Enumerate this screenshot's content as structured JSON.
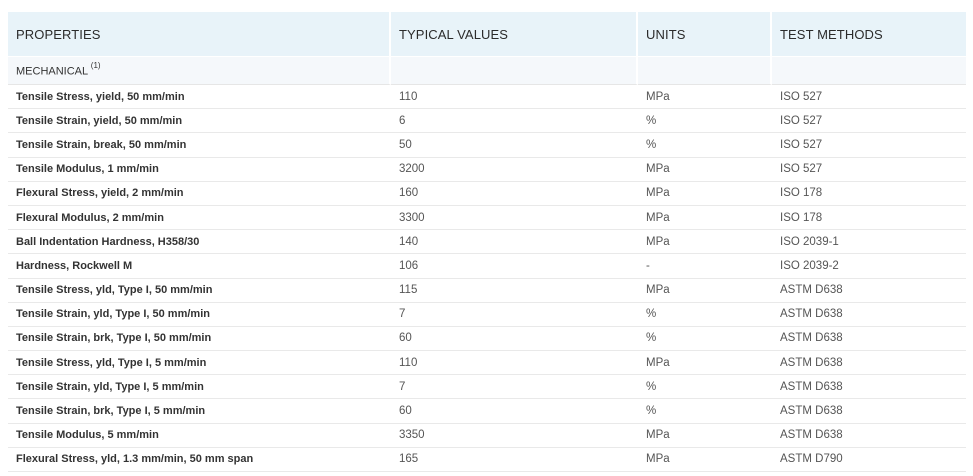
{
  "headers": {
    "properties": "PROPERTIES",
    "typical_values": "TYPICAL VALUES",
    "units": "UNITS",
    "test_methods": "TEST METHODS"
  },
  "section": {
    "label": "MECHANICAL",
    "footnote": "(1)"
  },
  "rows": [
    {
      "property": "Tensile Stress, yield, 50 mm/min",
      "value": "110",
      "unit": "MPa",
      "method": "ISO 527"
    },
    {
      "property": "Tensile Strain, yield, 50 mm/min",
      "value": "6",
      "unit": "%",
      "method": "ISO 527"
    },
    {
      "property": "Tensile Strain, break, 50 mm/min",
      "value": "50",
      "unit": "%",
      "method": "ISO 527"
    },
    {
      "property": "Tensile Modulus, 1 mm/min",
      "value": "3200",
      "unit": "MPa",
      "method": "ISO 527"
    },
    {
      "property": "Flexural Stress, yield, 2 mm/min",
      "value": "160",
      "unit": "MPa",
      "method": "ISO 178"
    },
    {
      "property": "Flexural Modulus, 2 mm/min",
      "value": "3300",
      "unit": "MPa",
      "method": "ISO 178"
    },
    {
      "property": "Ball Indentation Hardness, H358/30",
      "value": "140",
      "unit": "MPa",
      "method": "ISO 2039-1"
    },
    {
      "property": "Hardness, Rockwell M",
      "value": "106",
      "unit": "-",
      "method": "ISO 2039-2"
    },
    {
      "property": "Tensile Stress, yld, Type I, 50 mm/min",
      "value": "115",
      "unit": "MPa",
      "method": "ASTM D638"
    },
    {
      "property": "Tensile Strain, yld, Type I, 50 mm/min",
      "value": "7",
      "unit": "%",
      "method": "ASTM D638"
    },
    {
      "property": "Tensile Strain, brk, Type I, 50 mm/min",
      "value": "60",
      "unit": "%",
      "method": "ASTM D638"
    },
    {
      "property": "Tensile Stress, yld, Type I, 5 mm/min",
      "value": "110",
      "unit": "MPa",
      "method": "ASTM D638"
    },
    {
      "property": "Tensile Strain, yld, Type I, 5 mm/min",
      "value": "7",
      "unit": "%",
      "method": "ASTM D638"
    },
    {
      "property": "Tensile Strain, brk, Type I, 5 mm/min",
      "value": "60",
      "unit": "%",
      "method": "ASTM D638"
    },
    {
      "property": "Tensile Modulus, 5 mm/min",
      "value": "3350",
      "unit": "MPa",
      "method": "ASTM D638"
    },
    {
      "property": "Flexural Stress, yld, 1.3 mm/min, 50 mm span",
      "value": "165",
      "unit": "MPa",
      "method": "ASTM D790"
    }
  ]
}
